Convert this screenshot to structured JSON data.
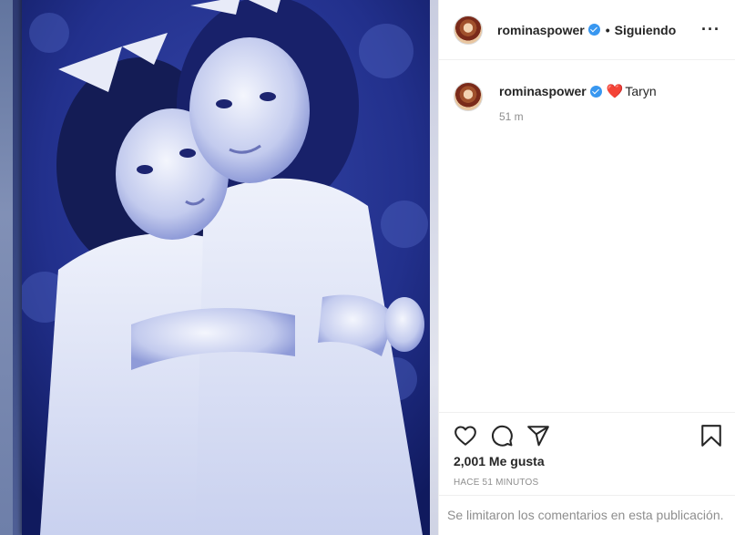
{
  "post": {
    "username": "rominaspower",
    "follow_status": "Siguiendo",
    "separator": "•",
    "more_label": "···",
    "caption": {
      "heart": "❤️",
      "text": "Taryn"
    },
    "timestamp": "51 m",
    "likes": "2,001 Me gusta",
    "posted_ago": "HACE 51 MINUTOS",
    "comments_notice": "Se limitaron los comentarios en esta publicación.",
    "verified": true
  },
  "icons": {
    "like": "heart-icon",
    "comment": "comment-icon",
    "share": "share-icon",
    "save": "bookmark-icon",
    "more": "more-options-icon",
    "verified": "verified-badge-icon"
  },
  "colors": {
    "verified_blue": "#3897f0",
    "muted_text": "#8e8e8e",
    "primary_text": "#262626",
    "photo_tint": "#1d2a86"
  }
}
